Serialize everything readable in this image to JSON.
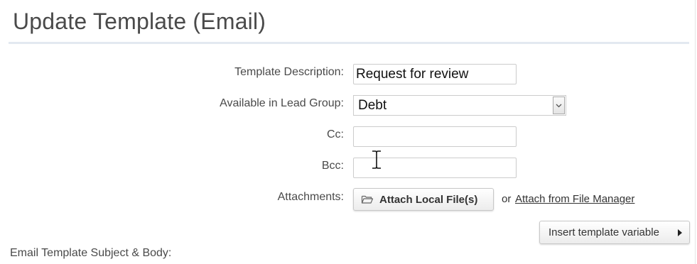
{
  "page": {
    "title": "Update Template (Email)"
  },
  "form": {
    "template_description": {
      "label": "Template Description:",
      "value": "Request for review"
    },
    "lead_group": {
      "label": "Available in Lead Group:",
      "selected": "Debt"
    },
    "cc": {
      "label": "Cc:",
      "value": ""
    },
    "bcc": {
      "label": "Bcc:",
      "value": ""
    },
    "attachments": {
      "label": "Attachments:",
      "attach_local_label": "Attach Local File(s)",
      "or_text": "or",
      "file_manager_link": "Attach from File Manager"
    }
  },
  "toolbar": {
    "insert_variable_label": "Insert template variable"
  },
  "body_section": {
    "label": "Email Template Subject & Body:"
  },
  "icons": {
    "attach": "folder-open-icon",
    "select": "chevron-down-icon",
    "insert": "caret-right-icon",
    "cursor": "text-cursor-icon"
  }
}
